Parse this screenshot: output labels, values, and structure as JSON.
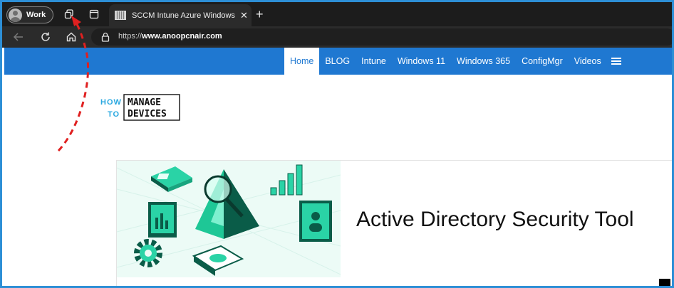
{
  "browser": {
    "profile_label": "Work",
    "tab_title": "SCCM Intune Azure Windows VD",
    "tab_close": "✕",
    "new_tab": "+",
    "url_scheme": "https://",
    "url_domain": "www.anoopcnair.com"
  },
  "site": {
    "nav": [
      "Home",
      "BLOG",
      "Intune",
      "Windows 11",
      "Windows 365",
      "ConfigMgr",
      "Videos"
    ],
    "logo": {
      "how": "HOW",
      "to": "TO",
      "manage": "MANAGE",
      "devices": "DEVICES"
    },
    "hero_title": "Active Directory Security Tool"
  },
  "colors": {
    "nav_bg": "#1f78d1",
    "frame_border": "#2d8fd6",
    "annotation_arrow": "#e02020",
    "logo_accent": "#29a8e0"
  },
  "icons": [
    "workspaces-icon",
    "tab-actions-icon",
    "back-icon",
    "refresh-icon",
    "home-icon",
    "lock-icon",
    "menu-icon"
  ]
}
